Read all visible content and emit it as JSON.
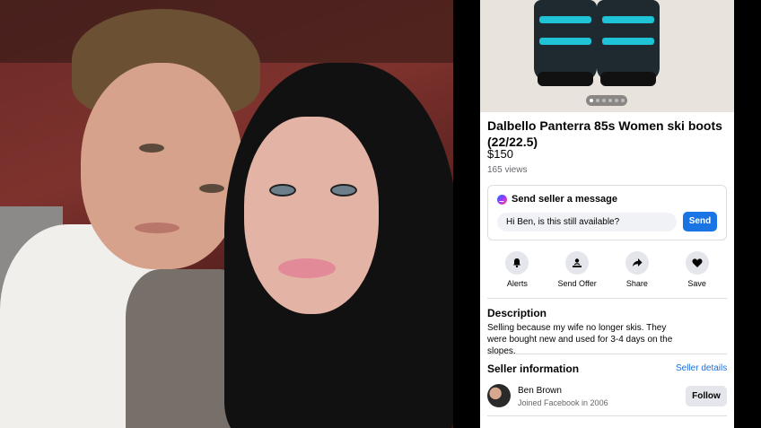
{
  "listing": {
    "title": "Dalbello Panterra 85s Women ski boots (22/22.5)",
    "price": "$150",
    "views": "165 views"
  },
  "message": {
    "header": "Send seller a message",
    "input_value": "Hi Ben, is this still available?",
    "send_label": "Send"
  },
  "actions": [
    {
      "label": "Alerts",
      "icon": "bell-icon"
    },
    {
      "label": "Send Offer",
      "icon": "offer-icon"
    },
    {
      "label": "Share",
      "icon": "share-icon"
    },
    {
      "label": "Save",
      "icon": "heart-icon"
    }
  ],
  "description": {
    "title": "Description",
    "text": "Selling because my wife no longer skis.  They were bought new and used for 3-4 days on the slopes."
  },
  "seller": {
    "section_title": "Seller information",
    "details_link": "Seller details",
    "name": "Ben Brown",
    "joined": "Joined Facebook in 2006",
    "follow_label": "Follow"
  },
  "colors": {
    "accent": "#1b74e4",
    "link": "#216fdb"
  }
}
